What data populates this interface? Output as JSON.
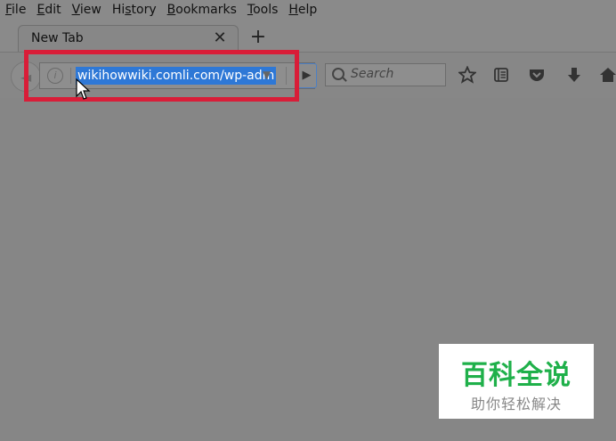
{
  "menu": {
    "items": [
      {
        "label": "File",
        "accel": "F",
        "rest": "ile"
      },
      {
        "label": "Edit",
        "accel": "E",
        "rest": "dit"
      },
      {
        "label": "View",
        "accel": "V",
        "rest": "iew"
      },
      {
        "label": "History",
        "accel": "",
        "pre": "Hi",
        "mid": "s",
        "rest": "tory"
      },
      {
        "label": "Bookmarks",
        "accel": "B",
        "rest": "ookmarks"
      },
      {
        "label": "Tools",
        "accel": "T",
        "rest": "ools"
      },
      {
        "label": "Help",
        "accel": "H",
        "rest": "elp"
      }
    ]
  },
  "tab": {
    "title": "New Tab",
    "close_glyph": "✕"
  },
  "newtab_glyph": "+",
  "urlbar": {
    "value": "wikihowwiki.comli.com/wp-adm",
    "info_glyph": "i",
    "dropdown_glyph": "▼"
  },
  "go_glyph": "▶",
  "search": {
    "placeholder": "Search"
  },
  "toolbar": {
    "icons": [
      "star-icon",
      "reading-list-icon",
      "pocket-icon",
      "download-icon",
      "home-icon"
    ]
  },
  "watermark": {
    "main": "百科全说",
    "sub": "助你轻松解决"
  },
  "colors": {
    "highlight_border": "#d91d38",
    "selection": "#2e78d6",
    "watermark_green": "#1fb04a"
  }
}
